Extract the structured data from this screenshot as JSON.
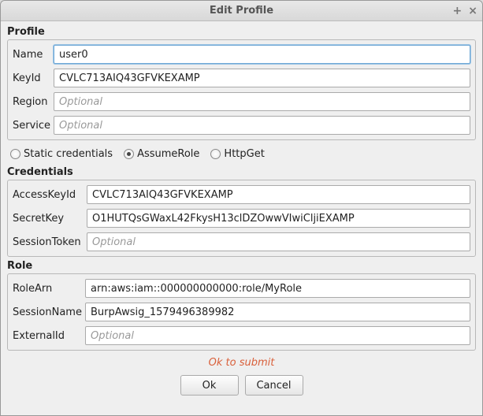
{
  "window": {
    "title": "Edit Profile"
  },
  "sections": {
    "profile": {
      "header": "Profile",
      "name_label": "Name",
      "name_value": "user0",
      "keyid_label": "KeyId",
      "keyid_value": "CVLC713AIQ43GFVKEXAMP",
      "region_label": "Region",
      "region_value": "",
      "region_placeholder": "Optional",
      "service_label": "Service",
      "service_value": "",
      "service_placeholder": "Optional"
    },
    "radios": {
      "static": "Static credentials",
      "assume": "AssumeRole",
      "httpget": "HttpGet",
      "selected": "assume"
    },
    "credentials": {
      "header": "Credentials",
      "access_label": "AccessKeyId",
      "access_value": "CVLC713AIQ43GFVKEXAMP",
      "secret_label": "SecretKey",
      "secret_value": "O1HUTQsGWaxL42FkysH13clDZOwwVIwiCljiEXAMP",
      "session_label": "SessionToken",
      "session_value": "",
      "session_placeholder": "Optional"
    },
    "role": {
      "header": "Role",
      "arn_label": "RoleArn",
      "arn_value": "arn:aws:iam::000000000000:role/MyRole",
      "session_label": "SessionName",
      "session_value": "BurpAwsig_1579496389982",
      "external_label": "ExternalId",
      "external_value": "",
      "external_placeholder": "Optional"
    }
  },
  "status": "Ok to submit",
  "buttons": {
    "ok": "Ok",
    "cancel": "Cancel"
  }
}
